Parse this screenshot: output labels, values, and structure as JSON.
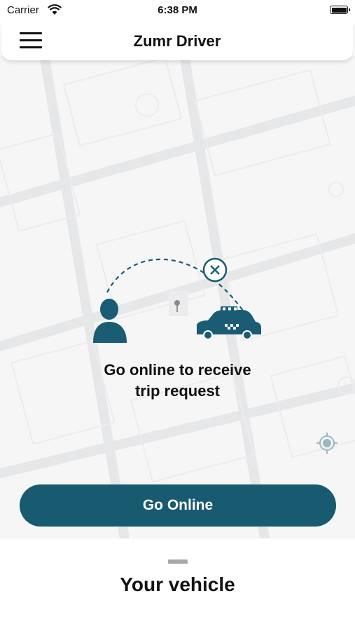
{
  "status_bar": {
    "carrier": "Carrier",
    "time": "6:38 PM"
  },
  "header": {
    "title": "Zumr Driver",
    "menu_icon": "hamburger-menu-icon"
  },
  "map": {
    "offline_message_line1": "Go online to receive",
    "offline_message_line2": "trip request",
    "illustration_icons": [
      "driver-person-icon",
      "pin-icon",
      "cancel-icon",
      "taxi-icon"
    ],
    "locate_icon": "crosshair-icon"
  },
  "actions": {
    "go_online_label": "Go Online"
  },
  "bottom_sheet": {
    "title": "Your vehicle"
  },
  "colors": {
    "primary": "#185a70",
    "map_background": "#f6f6f7",
    "illustration_teal": "#1a5c73"
  }
}
